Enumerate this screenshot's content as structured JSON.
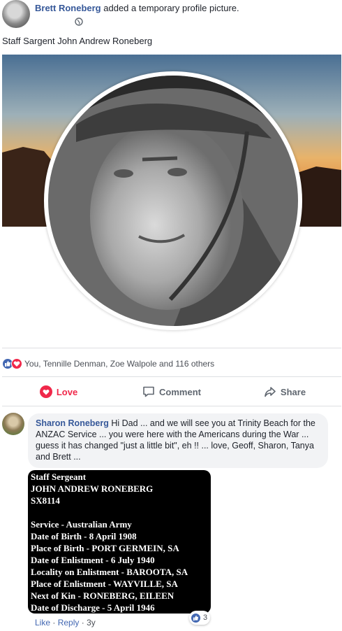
{
  "post": {
    "author": "Brett Roneberg",
    "action": "added a temporary profile picture.",
    "caption": "Staff Sargent John Andrew Roneberg"
  },
  "reactions": {
    "summary": "You, Tennille Denman, Zoe Walpole and 116 others"
  },
  "actions": {
    "love": "Love",
    "comment": "Comment",
    "share": "Share"
  },
  "comment": {
    "author": "Sharon Roneberg",
    "text": "Hi Dad ... and we will see you at Trinity Beach for the ANZAC Service ... you were here with the Americans during the War ... guess it has changed \"just a little bit\", eh !! ... love, Geoff, Sharon, Tanya and Brett ...",
    "card_lines_top": [
      "Staff Sergeant",
      "JOHN ANDREW RONEBERG",
      "SX8114"
    ],
    "card_lines_bottom": [
      "Service - Australian Army",
      "Date of Birth - 8 April 1908",
      "Place of Birth - PORT GERMEIN, SA",
      "Date of Enlistment - 6 July 1940",
      "Locality on Enlistment - BAROOTA, SA",
      "Place of Enlistment - WAYVILLE, SA",
      "Next of Kin - RONEBERG, EILEEN",
      "Date of Discharge - 5 April 1946"
    ],
    "like_label": "Like",
    "reply_label": "Reply",
    "separator": "·",
    "age": "3y",
    "like_count": "3"
  },
  "icons": {
    "privacy": "globe-icon",
    "like": "like-reaction-icon",
    "love": "love-reaction-icon",
    "comment": "comment-icon",
    "share": "share-icon"
  },
  "colors": {
    "link": "#365899",
    "like": "#4267b2",
    "love": "#f0284a",
    "bubble": "#f2f3f5"
  }
}
